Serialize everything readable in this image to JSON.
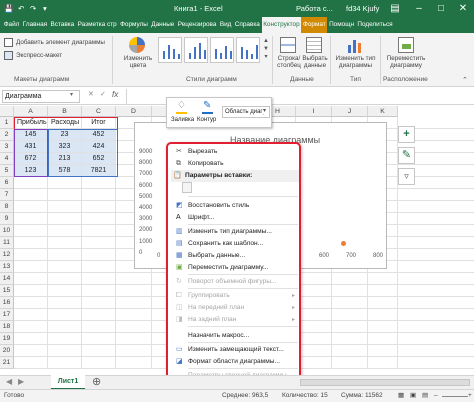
{
  "titlebar": {
    "qat_icons": [
      "save-icon",
      "undo-icon",
      "redo-icon"
    ],
    "title": "Книга1 - Excel",
    "context_title": "Работа с...",
    "user": "fd34 Kjufy"
  },
  "tabs": [
    {
      "label": "Файл",
      "active": false
    },
    {
      "label": "Главная",
      "active": false
    },
    {
      "label": "Вставка",
      "active": false
    },
    {
      "label": "Разметка стр",
      "active": false
    },
    {
      "label": "Формулы",
      "active": false
    },
    {
      "label": "Данные",
      "active": false
    },
    {
      "label": "Рецензирова",
      "active": false
    },
    {
      "label": "Вид",
      "active": false
    },
    {
      "label": "Справка",
      "active": false
    },
    {
      "label": "Конструктор",
      "active": true
    },
    {
      "label": "Формат",
      "active": false
    },
    {
      "label": "Помощн",
      "active": false
    },
    {
      "label": "Поделиться",
      "active": false
    }
  ],
  "ribbon": {
    "add_element": "Добавить элемент диаграммы",
    "quick_layout": "Экспресс-макет",
    "change_colors": "Изменить цвета",
    "layouts_group": "Макеты диаграмм",
    "styles_group": "Стили диаграмм",
    "row_col": "Строка/ столбец",
    "select_data": "Выбрать данные",
    "data_group": "Данные",
    "change_type": "Изменить тип диаграммы",
    "type_group": "Тип",
    "move_chart": "Переместить диаграмму",
    "location_group": "Расположение"
  },
  "namebox": "Диаграмма",
  "fx": "fx",
  "columns": [
    "A",
    "B",
    "C",
    "D",
    "E",
    "F",
    "G",
    "H",
    "I",
    "J",
    "K"
  ],
  "rows": [
    "1",
    "2",
    "3",
    "4",
    "5",
    "6",
    "7",
    "8",
    "9",
    "10",
    "11",
    "12",
    "13",
    "14",
    "15",
    "16",
    "17",
    "18",
    "19",
    "20",
    "21"
  ],
  "table": {
    "headers": [
      "Прибыль",
      "Расходы",
      "Итог"
    ],
    "data": [
      [
        "145",
        "23",
        "452"
      ],
      [
        "431",
        "323",
        "424"
      ],
      [
        "672",
        "213",
        "652"
      ],
      [
        "123",
        "578",
        "7821"
      ]
    ]
  },
  "chart": {
    "title": "Название диаграммы",
    "y_ticks": [
      "9000",
      "8000",
      "7000",
      "6000",
      "5000",
      "4000",
      "3000",
      "2000",
      "1000",
      "0"
    ],
    "x_ticks_visible": [
      "0",
      "600",
      "700",
      "800"
    ]
  },
  "mini_toolbar": {
    "fill_label": "Заливка",
    "outline_label": "Контур",
    "dropdown_value": "Область диагр"
  },
  "context_menu": {
    "items": [
      {
        "label": "Вырезать",
        "enabled": true,
        "icon": "scissors-icon"
      },
      {
        "label": "Копировать",
        "enabled": true,
        "icon": "copy-icon"
      },
      {
        "label": "Параметры вставки:",
        "enabled": true,
        "icon": "paste-icon",
        "header": true
      },
      {
        "label": "",
        "enabled": false,
        "icon": "clipboard-icon"
      },
      {
        "label": "Восстановить стиль",
        "enabled": true,
        "icon": "reset-style-icon"
      },
      {
        "label": "Шрифт...",
        "enabled": true,
        "icon": "font-icon"
      },
      {
        "label": "Изменить тип диаграммы...",
        "enabled": true,
        "icon": "chart-type-icon"
      },
      {
        "label": "Сохранить как шаблон...",
        "enabled": true,
        "icon": "template-icon"
      },
      {
        "label": "Выбрать данные...",
        "enabled": true,
        "icon": "select-data-icon"
      },
      {
        "label": "Переместить диаграмму...",
        "enabled": true,
        "icon": "move-chart-icon"
      },
      {
        "label": "Поворот объемной фигуры...",
        "enabled": false,
        "icon": "rotate-icon"
      },
      {
        "label": "Группировать",
        "enabled": false,
        "icon": "group-icon",
        "submenu": true
      },
      {
        "label": "На передний план",
        "enabled": false,
        "icon": "bring-forward-icon",
        "submenu": true
      },
      {
        "label": "На задний план",
        "enabled": false,
        "icon": "send-backward-icon",
        "submenu": true
      },
      {
        "label": "Назначить макрос...",
        "enabled": true,
        "icon": "macro-icon"
      },
      {
        "label": "Изменить замещающий текст...",
        "enabled": true,
        "icon": "alt-text-icon"
      },
      {
        "label": "Формат области диаграммы...",
        "enabled": true,
        "icon": "format-area-icon"
      },
      {
        "label": "Параметры сводной диаграммы...",
        "enabled": false,
        "icon": "pivot-options-icon"
      }
    ]
  },
  "sheet_tab": "Лист1",
  "status": {
    "ready": "Готово",
    "average": "Среднее: 963,5",
    "count": "Количество: 15",
    "sum": "Сумма: 11562"
  },
  "colors": {
    "excel_green": "#217346",
    "context_orange": "#d18a00",
    "highlight_red": "#e02030",
    "series_purple": "#7f3fbf",
    "series_blue": "#4472c4",
    "series_orange": "#ed7d31"
  }
}
